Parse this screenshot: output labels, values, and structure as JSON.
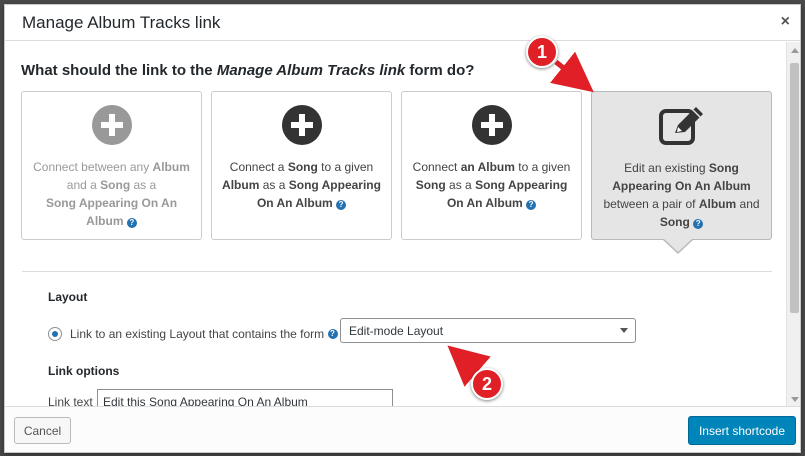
{
  "dialog": {
    "title": "Manage Album Tracks link",
    "close_glyph": "×"
  },
  "question": {
    "prefix": "What should the link to the ",
    "form_name": "Manage Album Tracks link",
    "suffix": " form do?"
  },
  "options": [
    {
      "icon": "plus-circle-icon",
      "state": "disabled",
      "parts": [
        "Connect between any ",
        "Album",
        " and a ",
        "Song",
        " as a ",
        "Song Appearing On An Album"
      ]
    },
    {
      "icon": "plus-circle-icon",
      "state": "enabled",
      "parts": [
        "Connect a ",
        "Song",
        " to a given ",
        "Album",
        " as a ",
        "Song Appearing On An Album"
      ]
    },
    {
      "icon": "plus-circle-icon",
      "state": "enabled",
      "parts": [
        "Connect ",
        "an Album",
        " to a given ",
        "Song",
        " as a ",
        "Song Appearing On An Album"
      ]
    },
    {
      "icon": "edit-square-icon",
      "state": "selected",
      "parts": [
        "Edit an existing ",
        "Song Appearing On An Album",
        " between a pair of ",
        "Album",
        " and ",
        "Song"
      ]
    }
  ],
  "help_glyph": "?",
  "layout": {
    "section_label": "Layout",
    "radio_label": "Link to an existing Layout that contains the form",
    "selected_layout": "Edit-mode Layout"
  },
  "link_options": {
    "section_label": "Link options",
    "link_text_label": "Link text",
    "link_text_value": "Edit this Song Appearing On An Album"
  },
  "footer": {
    "cancel_label": "Cancel",
    "insert_label": "Insert shortcode"
  },
  "annotations": {
    "badge_1": "1",
    "badge_2": "2",
    "color": "#e01f26"
  },
  "colors": {
    "primary_button": "#0085ba",
    "selected_card": "#e5e5e5",
    "icon_dark": "#333333",
    "icon_disabled": "#999999"
  }
}
